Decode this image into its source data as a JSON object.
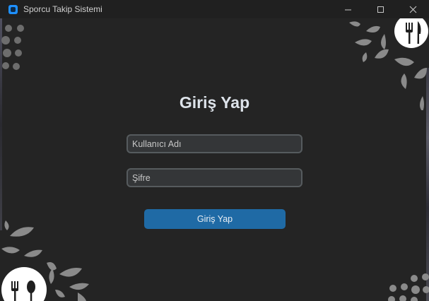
{
  "window": {
    "title": "Sporcu Takip Sistemi",
    "controls": [
      "minimize",
      "maximize",
      "close"
    ]
  },
  "login": {
    "heading": "Giriş Yap",
    "username_placeholder": "Kullanıcı Adı",
    "username_value": "",
    "password_placeholder": "Şifre",
    "password_value": "",
    "submit_label": "Giriş Yap"
  },
  "colors": {
    "background": "#242424",
    "input_bg": "#343638",
    "input_border": "#565b5e",
    "button": "#1f6aa5",
    "heading": "#dde3ea",
    "accent_icon": "#1e90ff"
  },
  "icons": {
    "app": "app-window-icon",
    "minimize": "minimize-icon",
    "maximize": "maximize-icon",
    "close": "close-icon",
    "decor_top_right": "fork-knife-icon",
    "decor_bottom_left": "fork-spoon-icon"
  }
}
